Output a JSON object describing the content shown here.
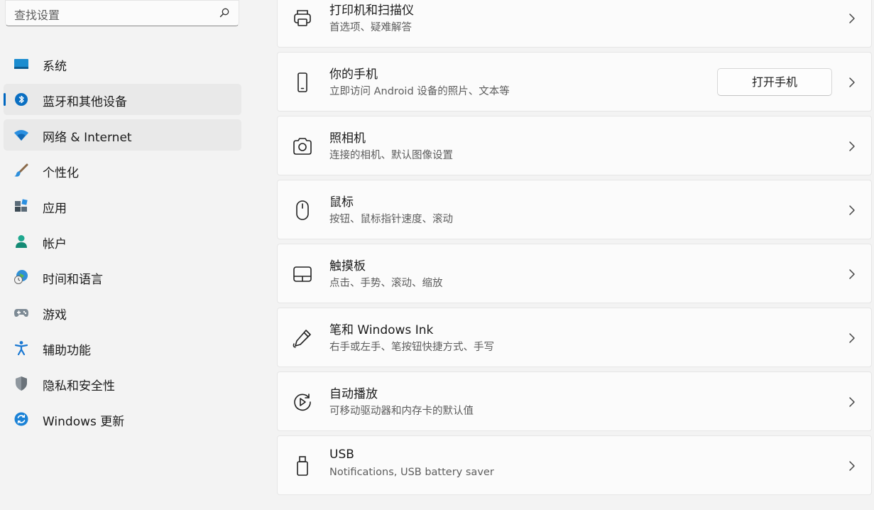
{
  "search": {
    "placeholder": "查找设置"
  },
  "sidebar": {
    "items": [
      {
        "label": "系统"
      },
      {
        "label": "蓝牙和其他设备"
      },
      {
        "label": "网络 & Internet"
      },
      {
        "label": "个性化"
      },
      {
        "label": "应用"
      },
      {
        "label": "帐户"
      },
      {
        "label": "时间和语言"
      },
      {
        "label": "游戏"
      },
      {
        "label": "辅助功能"
      },
      {
        "label": "隐私和安全性"
      },
      {
        "label": "Windows 更新"
      }
    ]
  },
  "main": {
    "items": [
      {
        "title": "打印机和扫描仪",
        "subtitle": "首选项、疑难解答",
        "icon": "printer-icon"
      },
      {
        "title": "你的手机",
        "subtitle": "立即访问 Android 设备的照片、文本等",
        "icon": "phone-icon",
        "button_label": "打开手机"
      },
      {
        "title": "照相机",
        "subtitle": "连接的相机、默认图像设置",
        "icon": "camera-icon"
      },
      {
        "title": "鼠标",
        "subtitle": "按钮、鼠标指针速度、滚动",
        "icon": "mouse-icon"
      },
      {
        "title": "触摸板",
        "subtitle": "点击、手势、滚动、缩放",
        "icon": "touchpad-icon"
      },
      {
        "title": "笔和 Windows Ink",
        "subtitle": "右手或左手、笔按钮快捷方式、手写",
        "icon": "pen-icon"
      },
      {
        "title": "自动播放",
        "subtitle": "可移动驱动器和内存卡的默认值",
        "icon": "autoplay-icon"
      },
      {
        "title": "USB",
        "subtitle": "Notifications, USB battery saver",
        "icon": "usb-icon"
      }
    ]
  },
  "colors": {
    "accent": "#0067c0",
    "background": "#f3f3f3",
    "card": "#fbfbfb"
  }
}
